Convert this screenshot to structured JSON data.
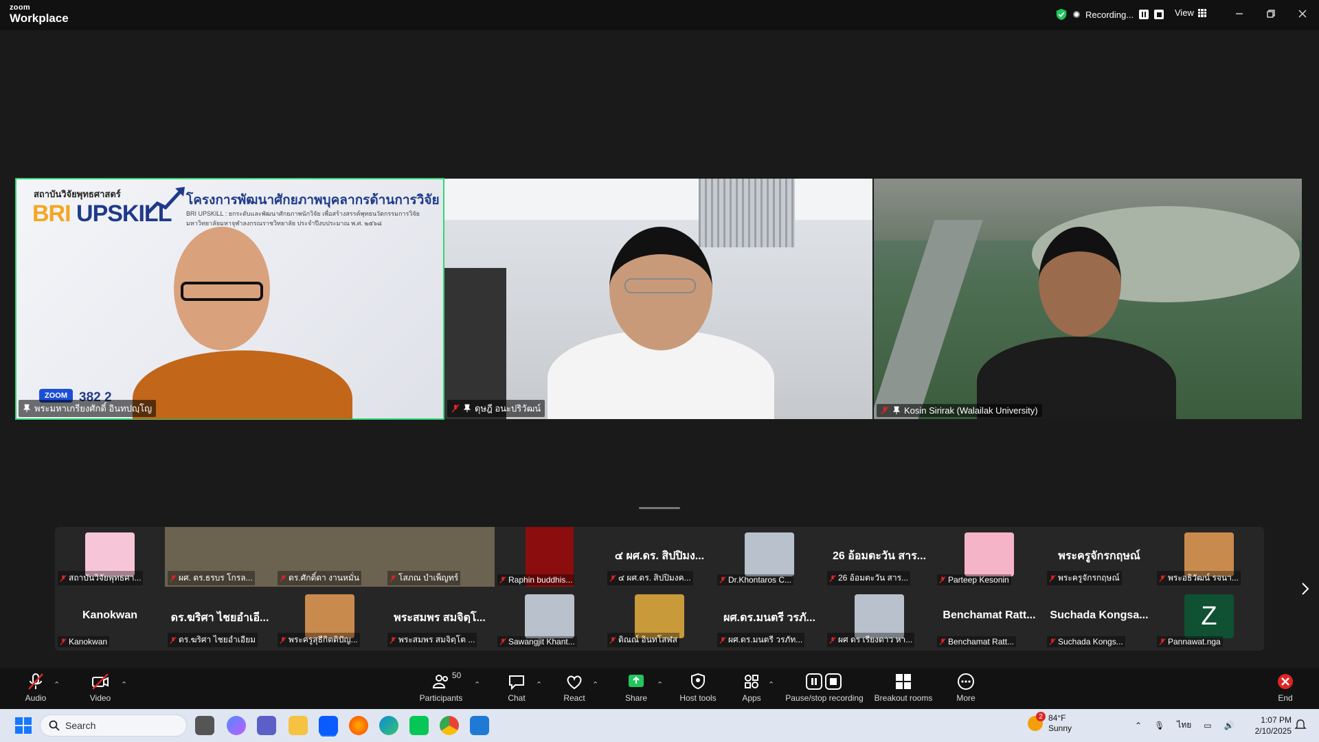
{
  "app": {
    "brand_small": "zoom",
    "brand_big": "Workplace",
    "recording_label": "Recording...",
    "view_label": "View"
  },
  "stage": {
    "tiles": [
      {
        "name": "พระมหาเกรียงศักดิ์ อินทปญฺโญ",
        "slide_logo_text": "สถาบันวิจัยพุทธศาสตร์",
        "slide_brand_1": "BRI",
        "slide_brand_2": "UPSKILL",
        "slide_title": "โครงการพัฒนาศักยภาพบุคลากรด้านการวิจัย",
        "slide_subtitle": "BRI UPSKILL : ยกระดับและพัฒนาศักยภาพนักวิจัย เพื่อสร้างสรรค์พุทธนวัตกรรมการวิจัย มหาวิทยาลัยมหาจุฬาลงกรณราชวิทยาลัย ประจำปีงบประมาณ พ.ศ. ๒๕๖๘",
        "zoom_badge": "ZOOM",
        "zoom_number": "382 2"
      },
      {
        "name": "ดุษฎี อนะปริวัฒน์"
      },
      {
        "name": "Kosin Sirirak (Walailak University)"
      }
    ]
  },
  "gallery": {
    "row1": [
      {
        "big": "",
        "tag": "สถาบันวิจัยพุทธศา...",
        "kind": "logo"
      },
      {
        "big": "",
        "tag": "ผศ. ดร.ธรบร โกรล...",
        "kind": "photo"
      },
      {
        "big": "",
        "tag": "ดร.ศักดิ์ดา งานหมั่น",
        "kind": "photo"
      },
      {
        "big": "",
        "tag": "โสภณ บำเพ็ญทร์",
        "kind": "photo"
      },
      {
        "big": "",
        "tag": "Raphin buddhis...",
        "kind": "red"
      },
      {
        "big": "๔ ผศ.ดร. สิปปิมง...",
        "tag": "๔ ผศ.ดร. สิปปิมงค...",
        "kind": "text"
      },
      {
        "big": "",
        "tag": "Dr.Khontaros C...",
        "kind": "portrait"
      },
      {
        "big": "26 อ้อมตะวัน สาร...",
        "tag": "26 อ้อมตะวัน สาร...",
        "kind": "text"
      },
      {
        "big": "",
        "tag": "Parteep Kesonin",
        "kind": "flower"
      },
      {
        "big": "พระครูจักรกฤษณ์",
        "tag": "พระครูจักรกฤษณ์",
        "kind": "text"
      },
      {
        "big": "",
        "tag": "พระอธิวัฒน์ รจนา...",
        "kind": "monk"
      }
    ],
    "row2": [
      {
        "big": "Kanokwan",
        "tag": "Kanokwan",
        "kind": "text"
      },
      {
        "big": "ดร.ฆริศา ไชยอำเอี...",
        "tag": "ดร.ฆริศา ไชยอำเอียม",
        "kind": "text"
      },
      {
        "big": "",
        "tag": "พระครูสุธีกิตติปัญ...",
        "kind": "monk"
      },
      {
        "big": "พระสมพร สมจิตฺโ...",
        "tag": "พระสมพร สมจิตฺโต ...",
        "kind": "text"
      },
      {
        "big": "",
        "tag": "Sawangjit Khant...",
        "kind": "portrait"
      },
      {
        "big": "",
        "tag": "ดิณณ์ อินทโสฬส",
        "kind": "shrine"
      },
      {
        "big": "ผศ.ดร.มนตรี วรภั...",
        "tag": "ผศ.ดร.มนตรี วรภัท...",
        "kind": "text"
      },
      {
        "big": "",
        "tag": "ผศ ดร เรียงดาว หา...",
        "kind": "portrait"
      },
      {
        "big": "Benchamat Ratt...",
        "tag": "Benchamat Ratt...",
        "kind": "text"
      },
      {
        "big": "Suchada Kongsa...",
        "tag": "Suchada Kongs...",
        "kind": "text"
      },
      {
        "big": "Z",
        "tag": "Pannawat.nga",
        "kind": "letter"
      }
    ]
  },
  "toolbar": {
    "audio": "Audio",
    "video": "Video",
    "participants": "Participants",
    "participants_count": "50",
    "chat": "Chat",
    "react": "React",
    "share": "Share",
    "host_tools": "Host tools",
    "apps": "Apps",
    "pause_stop": "Pause/stop recording",
    "breakout": "Breakout rooms",
    "more": "More",
    "end": "End"
  },
  "taskbar": {
    "search_placeholder": "Search",
    "weather_temp": "84°F",
    "weather_desc": "Sunny",
    "weather_alerts": "2",
    "language": "ไทย",
    "time": "1:07 PM",
    "date": "2/10/2025"
  },
  "colors": {
    "active_speaker": "#2ed573",
    "share_green": "#22c55e",
    "end_red": "#e02424"
  }
}
